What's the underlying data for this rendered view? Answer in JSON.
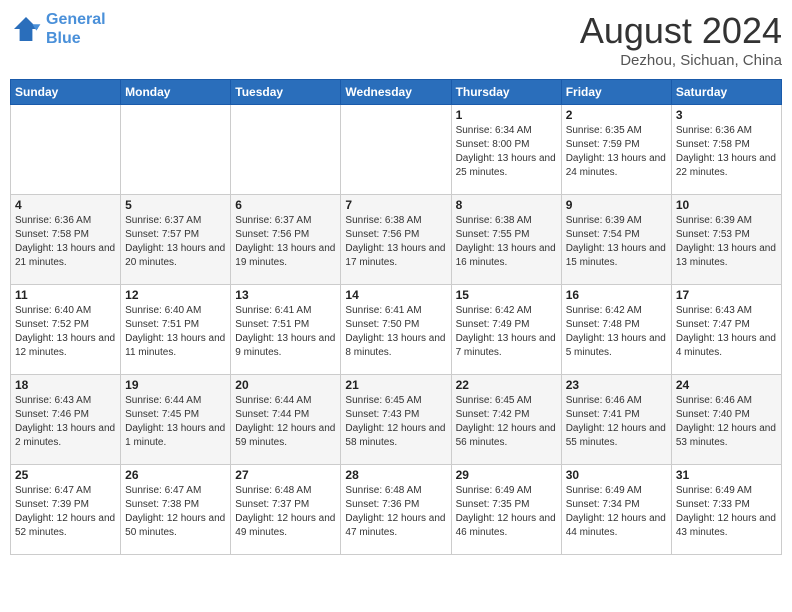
{
  "header": {
    "logo_line1": "General",
    "logo_line2": "Blue",
    "month": "August 2024",
    "location": "Dezhou, Sichuan, China"
  },
  "days_of_week": [
    "Sunday",
    "Monday",
    "Tuesday",
    "Wednesday",
    "Thursday",
    "Friday",
    "Saturday"
  ],
  "weeks": [
    [
      {
        "day": "",
        "sunrise": "",
        "sunset": "",
        "daylight": ""
      },
      {
        "day": "",
        "sunrise": "",
        "sunset": "",
        "daylight": ""
      },
      {
        "day": "",
        "sunrise": "",
        "sunset": "",
        "daylight": ""
      },
      {
        "day": "",
        "sunrise": "",
        "sunset": "",
        "daylight": ""
      },
      {
        "day": "1",
        "sunrise": "Sunrise: 6:34 AM",
        "sunset": "Sunset: 8:00 PM",
        "daylight": "Daylight: 13 hours and 25 minutes."
      },
      {
        "day": "2",
        "sunrise": "Sunrise: 6:35 AM",
        "sunset": "Sunset: 7:59 PM",
        "daylight": "Daylight: 13 hours and 24 minutes."
      },
      {
        "day": "3",
        "sunrise": "Sunrise: 6:36 AM",
        "sunset": "Sunset: 7:58 PM",
        "daylight": "Daylight: 13 hours and 22 minutes."
      }
    ],
    [
      {
        "day": "4",
        "sunrise": "Sunrise: 6:36 AM",
        "sunset": "Sunset: 7:58 PM",
        "daylight": "Daylight: 13 hours and 21 minutes."
      },
      {
        "day": "5",
        "sunrise": "Sunrise: 6:37 AM",
        "sunset": "Sunset: 7:57 PM",
        "daylight": "Daylight: 13 hours and 20 minutes."
      },
      {
        "day": "6",
        "sunrise": "Sunrise: 6:37 AM",
        "sunset": "Sunset: 7:56 PM",
        "daylight": "Daylight: 13 hours and 19 minutes."
      },
      {
        "day": "7",
        "sunrise": "Sunrise: 6:38 AM",
        "sunset": "Sunset: 7:56 PM",
        "daylight": "Daylight: 13 hours and 17 minutes."
      },
      {
        "day": "8",
        "sunrise": "Sunrise: 6:38 AM",
        "sunset": "Sunset: 7:55 PM",
        "daylight": "Daylight: 13 hours and 16 minutes."
      },
      {
        "day": "9",
        "sunrise": "Sunrise: 6:39 AM",
        "sunset": "Sunset: 7:54 PM",
        "daylight": "Daylight: 13 hours and 15 minutes."
      },
      {
        "day": "10",
        "sunrise": "Sunrise: 6:39 AM",
        "sunset": "Sunset: 7:53 PM",
        "daylight": "Daylight: 13 hours and 13 minutes."
      }
    ],
    [
      {
        "day": "11",
        "sunrise": "Sunrise: 6:40 AM",
        "sunset": "Sunset: 7:52 PM",
        "daylight": "Daylight: 13 hours and 12 minutes."
      },
      {
        "day": "12",
        "sunrise": "Sunrise: 6:40 AM",
        "sunset": "Sunset: 7:51 PM",
        "daylight": "Daylight: 13 hours and 11 minutes."
      },
      {
        "day": "13",
        "sunrise": "Sunrise: 6:41 AM",
        "sunset": "Sunset: 7:51 PM",
        "daylight": "Daylight: 13 hours and 9 minutes."
      },
      {
        "day": "14",
        "sunrise": "Sunrise: 6:41 AM",
        "sunset": "Sunset: 7:50 PM",
        "daylight": "Daylight: 13 hours and 8 minutes."
      },
      {
        "day": "15",
        "sunrise": "Sunrise: 6:42 AM",
        "sunset": "Sunset: 7:49 PM",
        "daylight": "Daylight: 13 hours and 7 minutes."
      },
      {
        "day": "16",
        "sunrise": "Sunrise: 6:42 AM",
        "sunset": "Sunset: 7:48 PM",
        "daylight": "Daylight: 13 hours and 5 minutes."
      },
      {
        "day": "17",
        "sunrise": "Sunrise: 6:43 AM",
        "sunset": "Sunset: 7:47 PM",
        "daylight": "Daylight: 13 hours and 4 minutes."
      }
    ],
    [
      {
        "day": "18",
        "sunrise": "Sunrise: 6:43 AM",
        "sunset": "Sunset: 7:46 PM",
        "daylight": "Daylight: 13 hours and 2 minutes."
      },
      {
        "day": "19",
        "sunrise": "Sunrise: 6:44 AM",
        "sunset": "Sunset: 7:45 PM",
        "daylight": "Daylight: 13 hours and 1 minute."
      },
      {
        "day": "20",
        "sunrise": "Sunrise: 6:44 AM",
        "sunset": "Sunset: 7:44 PM",
        "daylight": "Daylight: 12 hours and 59 minutes."
      },
      {
        "day": "21",
        "sunrise": "Sunrise: 6:45 AM",
        "sunset": "Sunset: 7:43 PM",
        "daylight": "Daylight: 12 hours and 58 minutes."
      },
      {
        "day": "22",
        "sunrise": "Sunrise: 6:45 AM",
        "sunset": "Sunset: 7:42 PM",
        "daylight": "Daylight: 12 hours and 56 minutes."
      },
      {
        "day": "23",
        "sunrise": "Sunrise: 6:46 AM",
        "sunset": "Sunset: 7:41 PM",
        "daylight": "Daylight: 12 hours and 55 minutes."
      },
      {
        "day": "24",
        "sunrise": "Sunrise: 6:46 AM",
        "sunset": "Sunset: 7:40 PM",
        "daylight": "Daylight: 12 hours and 53 minutes."
      }
    ],
    [
      {
        "day": "25",
        "sunrise": "Sunrise: 6:47 AM",
        "sunset": "Sunset: 7:39 PM",
        "daylight": "Daylight: 12 hours and 52 minutes."
      },
      {
        "day": "26",
        "sunrise": "Sunrise: 6:47 AM",
        "sunset": "Sunset: 7:38 PM",
        "daylight": "Daylight: 12 hours and 50 minutes."
      },
      {
        "day": "27",
        "sunrise": "Sunrise: 6:48 AM",
        "sunset": "Sunset: 7:37 PM",
        "daylight": "Daylight: 12 hours and 49 minutes."
      },
      {
        "day": "28",
        "sunrise": "Sunrise: 6:48 AM",
        "sunset": "Sunset: 7:36 PM",
        "daylight": "Daylight: 12 hours and 47 minutes."
      },
      {
        "day": "29",
        "sunrise": "Sunrise: 6:49 AM",
        "sunset": "Sunset: 7:35 PM",
        "daylight": "Daylight: 12 hours and 46 minutes."
      },
      {
        "day": "30",
        "sunrise": "Sunrise: 6:49 AM",
        "sunset": "Sunset: 7:34 PM",
        "daylight": "Daylight: 12 hours and 44 minutes."
      },
      {
        "day": "31",
        "sunrise": "Sunrise: 6:49 AM",
        "sunset": "Sunset: 7:33 PM",
        "daylight": "Daylight: 12 hours and 43 minutes."
      }
    ]
  ]
}
